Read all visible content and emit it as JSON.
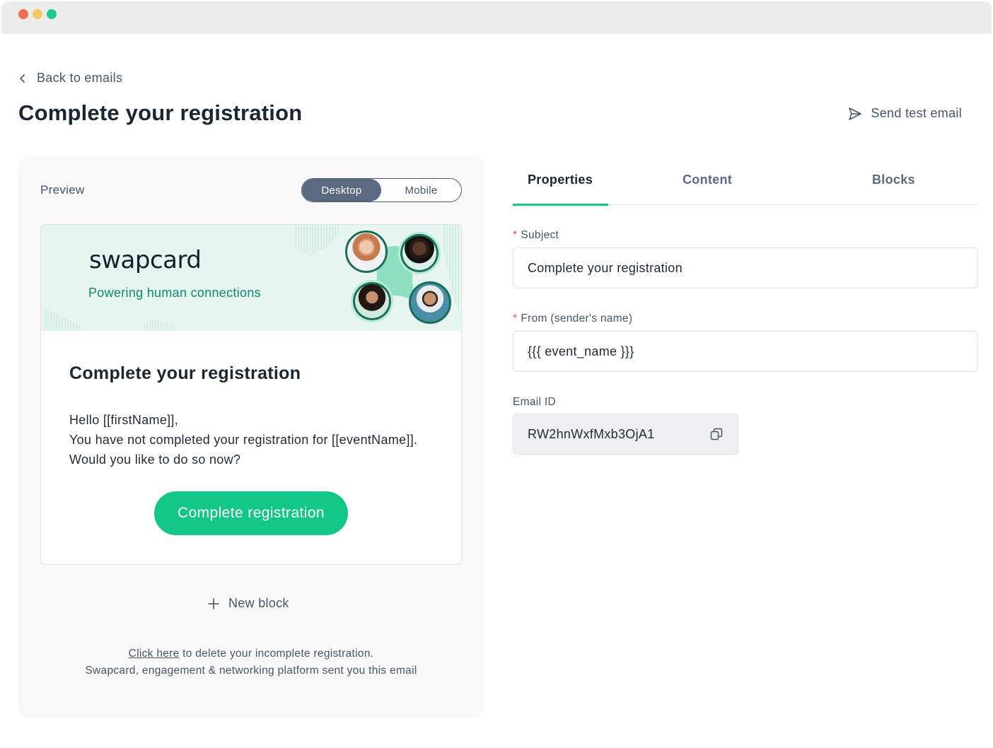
{
  "nav": {
    "back_label": "Back to emails"
  },
  "header": {
    "title": "Complete your registration",
    "send_test_label": "Send test email"
  },
  "preview": {
    "label": "Preview",
    "toggle": {
      "desktop": "Desktop",
      "mobile": "Mobile",
      "selected": "Desktop"
    },
    "email": {
      "brand": "swapcard",
      "tagline": "Powering human connections",
      "heading": "Complete your registration",
      "body_lines": [
        "Hello [[firstName]],",
        "You have not completed your registration for [[eventName]].",
        "Would you like to do so now?"
      ],
      "cta_label": "Complete registration"
    },
    "new_block_label": "New block",
    "footer": {
      "link_text": "Click here",
      "line1_rest": " to delete your incomplete registration.",
      "line2": "Swapcard, engagement & networking platform sent you this email"
    }
  },
  "tabs": [
    {
      "label": "Properties",
      "active": true
    },
    {
      "label": "Content",
      "active": false
    },
    {
      "label": "Blocks",
      "active": false
    }
  ],
  "form": {
    "subject": {
      "label": "Subject",
      "required_mark": "*",
      "value": "Complete your registration"
    },
    "from": {
      "label": "From (sender's name)",
      "required_mark": "*",
      "value": "{{{ event_name }}}"
    },
    "email_id": {
      "label": "Email ID",
      "value": "RW2hnWxfMxb3OjA1"
    }
  },
  "colors": {
    "accent": "#12c786",
    "toggle_active": "#5b6983",
    "banner_bg": "#e6f5ef",
    "tagline": "#0f8a68"
  }
}
